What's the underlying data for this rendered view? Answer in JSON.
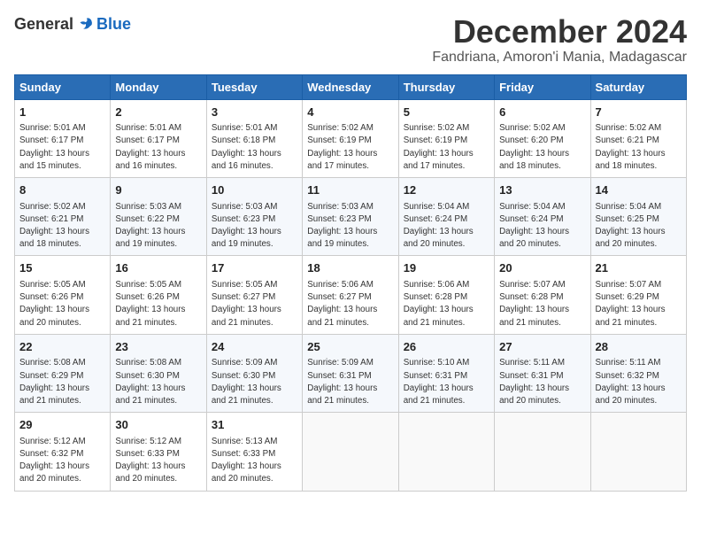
{
  "logo": {
    "general": "General",
    "blue": "Blue"
  },
  "title": {
    "month": "December 2024",
    "location": "Fandriana, Amoron'i Mania, Madagascar"
  },
  "weekdays": [
    "Sunday",
    "Monday",
    "Tuesday",
    "Wednesday",
    "Thursday",
    "Friday",
    "Saturday"
  ],
  "weeks": [
    [
      {
        "day": "1",
        "sunrise": "5:01 AM",
        "sunset": "6:17 PM",
        "daylight": "13 hours and 15 minutes."
      },
      {
        "day": "2",
        "sunrise": "5:01 AM",
        "sunset": "6:17 PM",
        "daylight": "13 hours and 16 minutes."
      },
      {
        "day": "3",
        "sunrise": "5:01 AM",
        "sunset": "6:18 PM",
        "daylight": "13 hours and 16 minutes."
      },
      {
        "day": "4",
        "sunrise": "5:02 AM",
        "sunset": "6:19 PM",
        "daylight": "13 hours and 17 minutes."
      },
      {
        "day": "5",
        "sunrise": "5:02 AM",
        "sunset": "6:19 PM",
        "daylight": "13 hours and 17 minutes."
      },
      {
        "day": "6",
        "sunrise": "5:02 AM",
        "sunset": "6:20 PM",
        "daylight": "13 hours and 18 minutes."
      },
      {
        "day": "7",
        "sunrise": "5:02 AM",
        "sunset": "6:21 PM",
        "daylight": "13 hours and 18 minutes."
      }
    ],
    [
      {
        "day": "8",
        "sunrise": "5:02 AM",
        "sunset": "6:21 PM",
        "daylight": "13 hours and 18 minutes."
      },
      {
        "day": "9",
        "sunrise": "5:03 AM",
        "sunset": "6:22 PM",
        "daylight": "13 hours and 19 minutes."
      },
      {
        "day": "10",
        "sunrise": "5:03 AM",
        "sunset": "6:23 PM",
        "daylight": "13 hours and 19 minutes."
      },
      {
        "day": "11",
        "sunrise": "5:03 AM",
        "sunset": "6:23 PM",
        "daylight": "13 hours and 19 minutes."
      },
      {
        "day": "12",
        "sunrise": "5:04 AM",
        "sunset": "6:24 PM",
        "daylight": "13 hours and 20 minutes."
      },
      {
        "day": "13",
        "sunrise": "5:04 AM",
        "sunset": "6:24 PM",
        "daylight": "13 hours and 20 minutes."
      },
      {
        "day": "14",
        "sunrise": "5:04 AM",
        "sunset": "6:25 PM",
        "daylight": "13 hours and 20 minutes."
      }
    ],
    [
      {
        "day": "15",
        "sunrise": "5:05 AM",
        "sunset": "6:26 PM",
        "daylight": "13 hours and 20 minutes."
      },
      {
        "day": "16",
        "sunrise": "5:05 AM",
        "sunset": "6:26 PM",
        "daylight": "13 hours and 21 minutes."
      },
      {
        "day": "17",
        "sunrise": "5:05 AM",
        "sunset": "6:27 PM",
        "daylight": "13 hours and 21 minutes."
      },
      {
        "day": "18",
        "sunrise": "5:06 AM",
        "sunset": "6:27 PM",
        "daylight": "13 hours and 21 minutes."
      },
      {
        "day": "19",
        "sunrise": "5:06 AM",
        "sunset": "6:28 PM",
        "daylight": "13 hours and 21 minutes."
      },
      {
        "day": "20",
        "sunrise": "5:07 AM",
        "sunset": "6:28 PM",
        "daylight": "13 hours and 21 minutes."
      },
      {
        "day": "21",
        "sunrise": "5:07 AM",
        "sunset": "6:29 PM",
        "daylight": "13 hours and 21 minutes."
      }
    ],
    [
      {
        "day": "22",
        "sunrise": "5:08 AM",
        "sunset": "6:29 PM",
        "daylight": "13 hours and 21 minutes."
      },
      {
        "day": "23",
        "sunrise": "5:08 AM",
        "sunset": "6:30 PM",
        "daylight": "13 hours and 21 minutes."
      },
      {
        "day": "24",
        "sunrise": "5:09 AM",
        "sunset": "6:30 PM",
        "daylight": "13 hours and 21 minutes."
      },
      {
        "day": "25",
        "sunrise": "5:09 AM",
        "sunset": "6:31 PM",
        "daylight": "13 hours and 21 minutes."
      },
      {
        "day": "26",
        "sunrise": "5:10 AM",
        "sunset": "6:31 PM",
        "daylight": "13 hours and 21 minutes."
      },
      {
        "day": "27",
        "sunrise": "5:11 AM",
        "sunset": "6:31 PM",
        "daylight": "13 hours and 20 minutes."
      },
      {
        "day": "28",
        "sunrise": "5:11 AM",
        "sunset": "6:32 PM",
        "daylight": "13 hours and 20 minutes."
      }
    ],
    [
      {
        "day": "29",
        "sunrise": "5:12 AM",
        "sunset": "6:32 PM",
        "daylight": "13 hours and 20 minutes."
      },
      {
        "day": "30",
        "sunrise": "5:12 AM",
        "sunset": "6:33 PM",
        "daylight": "13 hours and 20 minutes."
      },
      {
        "day": "31",
        "sunrise": "5:13 AM",
        "sunset": "6:33 PM",
        "daylight": "13 hours and 20 minutes."
      },
      null,
      null,
      null,
      null
    ]
  ]
}
